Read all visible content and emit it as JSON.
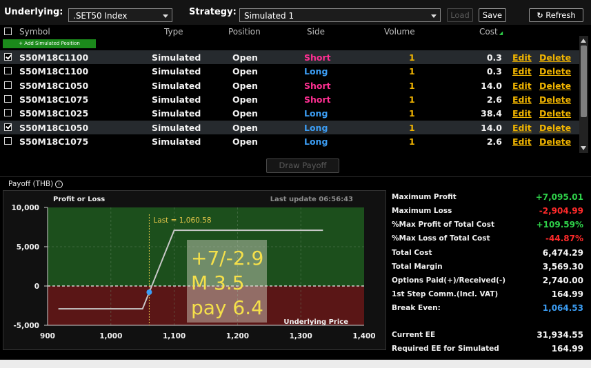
{
  "colors": {
    "background": "#000000",
    "short": "#ff2f92",
    "long": "#3c9ef5",
    "volume": "#f0b400",
    "add_button": "#1b8a1b",
    "profit_zone": "#1c4f1c",
    "loss_zone": "#5a1616",
    "annotation_text": "#f5e04a"
  },
  "toolbar": {
    "underlying_label": "Underlying:",
    "underlying_value": ".SET50 Index",
    "strategy_label": "Strategy:",
    "strategy_value": "Simulated 1",
    "load_label": "Load",
    "save_label": "Save",
    "refresh_label": "Refresh",
    "refresh_icon": "refresh-icon"
  },
  "table": {
    "headers": {
      "symbol": "Symbol",
      "type": "Type",
      "position": "Position",
      "side": "Side",
      "volume": "Volume",
      "cost": "Cost"
    },
    "add_button": "+ Add Simulated Position",
    "edit_label": "Edit",
    "delete_label": "Delete",
    "rows": [
      {
        "checked": true,
        "symbol": "S50M18C1100",
        "type": "Simulated",
        "position": "Open",
        "side": "Short",
        "volume": "1",
        "cost": "0.3"
      },
      {
        "checked": false,
        "symbol": "S50M18C1100",
        "type": "Simulated",
        "position": "Open",
        "side": "Long",
        "volume": "1",
        "cost": "0.3"
      },
      {
        "checked": false,
        "symbol": "S50M18C1050",
        "type": "Simulated",
        "position": "Open",
        "side": "Short",
        "volume": "1",
        "cost": "14.0"
      },
      {
        "checked": false,
        "symbol": "S50M18C1075",
        "type": "Simulated",
        "position": "Open",
        "side": "Short",
        "volume": "1",
        "cost": "2.6"
      },
      {
        "checked": false,
        "symbol": "S50M18C1025",
        "type": "Simulated",
        "position": "Open",
        "side": "Long",
        "volume": "1",
        "cost": "38.4"
      },
      {
        "checked": true,
        "symbol": "S50M18C1050",
        "type": "Simulated",
        "position": "Open",
        "side": "Long",
        "volume": "1",
        "cost": "14.0"
      },
      {
        "checked": false,
        "symbol": "S50M18C1075",
        "type": "Simulated",
        "position": "Open",
        "side": "Long",
        "volume": "1",
        "cost": "2.6"
      }
    ]
  },
  "draw_payoff_label": "Draw Payoff",
  "payoff_title": "Payoff (THB)",
  "info_icon": "info-icon",
  "chart_data": {
    "type": "line",
    "title": "Profit or Loss",
    "last_update": "Last update 06:56:43",
    "xlabel": "Underlying Price",
    "xlim": [
      900,
      1400
    ],
    "ylim": [
      -5000,
      10000
    ],
    "xticks": [
      "900",
      "1,000",
      "1,100",
      "1,200",
      "1,300",
      "1,400"
    ],
    "yticks": [
      "10,000",
      "5,000",
      "0",
      "-5,000"
    ],
    "xtick_values": [
      900,
      1000,
      1100,
      1200,
      1300,
      1400
    ],
    "ytick_values": [
      10000,
      5000,
      0,
      -5000
    ],
    "series": [
      {
        "x": [
          917,
          1050,
          1100,
          1335
        ],
        "values": [
          -2905,
          -2905,
          7095,
          7095
        ]
      }
    ],
    "last_price_label": "Last = 1,060.58",
    "last_price": 1060.58,
    "annotation_lines": [
      "+7/-2.9",
      "M 3.5",
      "pay 6.4"
    ],
    "grid": true
  },
  "stats": [
    {
      "label": "Maximum Profit",
      "value": "+7,095.01",
      "tone": "pos"
    },
    {
      "label": "Maximum Loss",
      "value": "-2,904.99",
      "tone": "neg"
    },
    {
      "label": "%Max Profit of Total Cost",
      "value": "+109.59%",
      "tone": "pos"
    },
    {
      "label": "%Max Loss of Total Cost",
      "value": "-44.87%",
      "tone": "neg"
    },
    {
      "label": "Total Cost",
      "value": "6,474.29",
      "tone": "wht"
    },
    {
      "label": "Total Margin",
      "value": "3,569.30",
      "tone": "wht"
    },
    {
      "label": "Options Paid(+)/Received(-)",
      "value": "2,740.00",
      "tone": "wht"
    },
    {
      "label": "1st Step Comm.(Incl. VAT)",
      "value": "164.99",
      "tone": "wht"
    },
    {
      "label": "Break Even:",
      "value": "1,064.53",
      "tone": "blu"
    }
  ],
  "ee_stats": [
    {
      "label": "Current EE",
      "value": "31,934.55",
      "tone": "wht"
    },
    {
      "label": "Required EE for Simulated",
      "value": "164.99",
      "tone": "wht"
    }
  ]
}
